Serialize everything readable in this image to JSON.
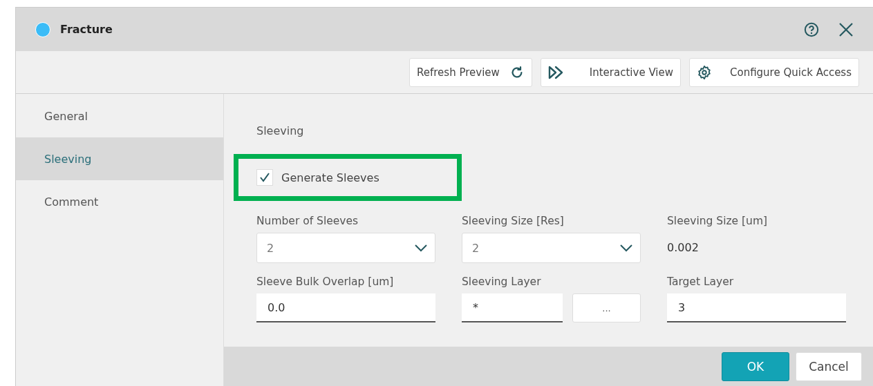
{
  "window": {
    "title": "Fracture"
  },
  "toolbar": [
    {
      "label": "Refresh Preview",
      "kind": "refresh"
    },
    {
      "label": "Interactive View",
      "kind": "forward"
    },
    {
      "label": "Configure Quick Access",
      "kind": "gear"
    }
  ],
  "sidebar": {
    "items": [
      {
        "label": "General",
        "selected": false
      },
      {
        "label": "Sleeving",
        "selected": true
      },
      {
        "label": "Comment",
        "selected": false
      }
    ]
  },
  "section": {
    "title": "Sleeving",
    "checkbox": {
      "label": "Generate Sleeves",
      "checked": true,
      "highlighted": true
    },
    "fields": [
      {
        "label": "Number of Sleeves",
        "kind": "dropdown",
        "value": "2"
      },
      {
        "label": "Sleeving Size [Res]",
        "kind": "dropdown",
        "value": "2"
      },
      {
        "label": "Sleeving Size [um]",
        "kind": "readonly",
        "value": "0.002"
      },
      {
        "label": "Sleeve Bulk Overlap [um]",
        "kind": "input",
        "value": "0.0"
      },
      {
        "label": "Sleeving Layer",
        "kind": "input-browse",
        "value": "*",
        "button": "..."
      },
      {
        "label": "Target Layer",
        "kind": "input",
        "value": "3"
      }
    ]
  },
  "buttons": [
    {
      "label": "OK",
      "kind": "primary"
    },
    {
      "label": "Cancel",
      "kind": "secondary"
    }
  ]
}
